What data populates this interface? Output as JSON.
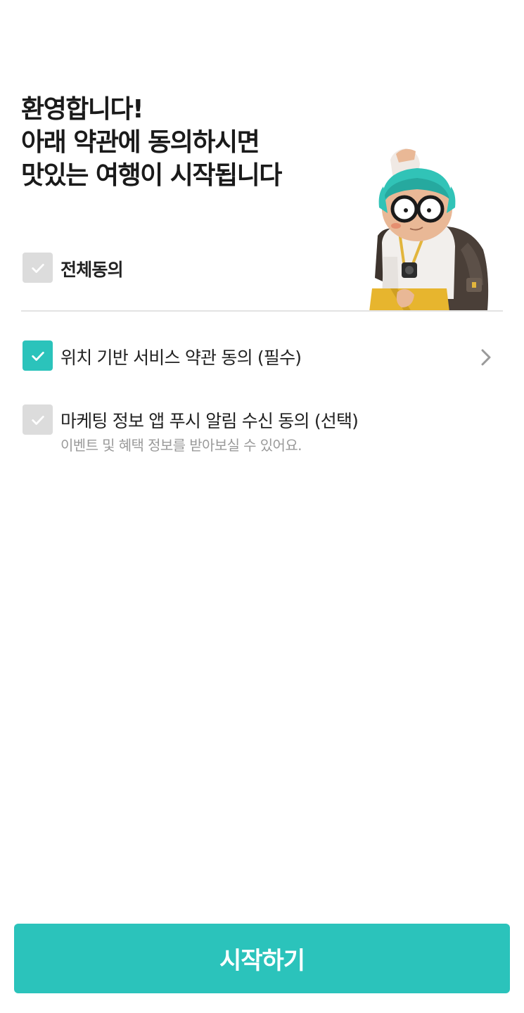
{
  "headline": {
    "line1": "환영합니다!",
    "line2": "아래 약관에 동의하시면",
    "line3": "맛있는 여행이 시작됩니다"
  },
  "agree_all": {
    "label": "전체동의",
    "checked": false
  },
  "terms": [
    {
      "label": "위치 기반 서비스 약관 동의 (필수)",
      "checked": true,
      "has_detail_link": true
    },
    {
      "label": "마케팅 정보 앱 푸시 알림 수신 동의 (선택)",
      "description": "이벤트 및 혜택 정보를 받아보실 수 있어요.",
      "checked": false
    }
  ],
  "start_button": {
    "label": "시작하기"
  },
  "icons": {
    "checkbox": "check-icon",
    "detail": "chevron-right-icon",
    "mascot": "traveler-mascot-illustration"
  },
  "colors": {
    "accent": "#2bc3bb",
    "checkbox_off": "#dcdcdc",
    "text_primary": "#222222",
    "text_secondary": "#9a9a9a",
    "divider": "#e3e3e3"
  }
}
